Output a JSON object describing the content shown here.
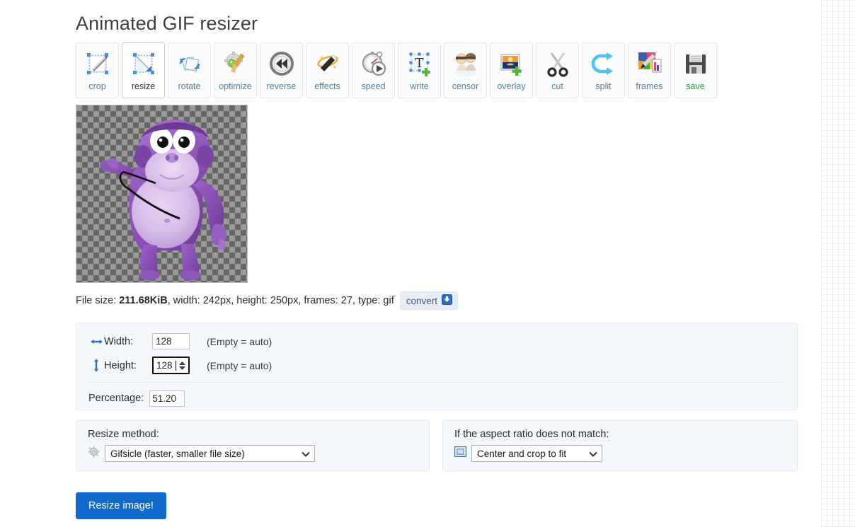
{
  "page": {
    "title": "Animated GIF resizer"
  },
  "toolbar": {
    "items": [
      {
        "label": "crop",
        "icon": "crop-icon",
        "active": false,
        "green": false
      },
      {
        "label": "resize",
        "icon": "resize-icon",
        "active": true,
        "green": false
      },
      {
        "label": "rotate",
        "icon": "rotate-icon",
        "active": false,
        "green": false
      },
      {
        "label": "optimize",
        "icon": "optimize-icon",
        "active": false,
        "green": false
      },
      {
        "label": "reverse",
        "icon": "reverse-icon",
        "active": false,
        "green": false
      },
      {
        "label": "effects",
        "icon": "effects-icon",
        "active": false,
        "green": false
      },
      {
        "label": "speed",
        "icon": "speed-icon",
        "active": false,
        "green": false
      },
      {
        "label": "write",
        "icon": "write-icon",
        "active": false,
        "green": false
      },
      {
        "label": "censor",
        "icon": "censor-icon",
        "active": false,
        "green": false
      },
      {
        "label": "overlay",
        "icon": "overlay-icon",
        "active": false,
        "green": false
      },
      {
        "label": "cut",
        "icon": "cut-icon",
        "active": false,
        "green": false
      },
      {
        "label": "split",
        "icon": "split-icon",
        "active": false,
        "green": false
      },
      {
        "label": "frames",
        "icon": "frames-icon",
        "active": false,
        "green": false
      },
      {
        "label": "save",
        "icon": "save-icon",
        "active": false,
        "green": true
      }
    ]
  },
  "preview": {
    "alt": "purple gorilla animated gif preview",
    "background": "transparency-checkerboard"
  },
  "file_info": {
    "size_label": "File size:",
    "size_value": "211.68KiB",
    "rest": ", width: 242px, height: 250px, frames: 27, type: gif",
    "convert_label": "convert",
    "convert_icon": "download-arrow-icon"
  },
  "size_panel": {
    "width": {
      "icon": "horizontal-arrow-icon",
      "label": "Width:",
      "value": "128",
      "hint": "(Empty = auto)"
    },
    "height": {
      "icon": "vertical-arrow-icon",
      "label": "Height:",
      "value": "128",
      "hint": "(Empty = auto)",
      "focused": true
    },
    "percentage": {
      "label": "Percentage:",
      "value": "51.20"
    }
  },
  "method_panel": {
    "title": "Resize method:",
    "icon": "gear-icon",
    "selected": "Gifsicle (faster, smaller file size)"
  },
  "aspect_panel": {
    "title": "If the aspect ratio does not match:",
    "icon": "crop-frame-icon",
    "selected": "Center and crop to fit"
  },
  "submit": {
    "label": "Resize image!"
  },
  "colors": {
    "accent_blue": "#1169cc",
    "tool_label": "#5f7d95",
    "save_green": "#2e9b3a",
    "panel_bg": "#f4f8fb"
  }
}
